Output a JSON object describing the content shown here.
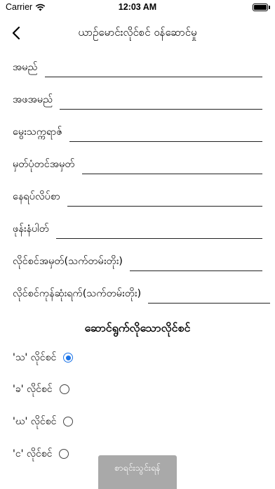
{
  "status_bar": {
    "carrier": "Carrier",
    "time": "12:03 AM"
  },
  "nav": {
    "title": "ယာဉ်မောင်းလိုင်စင် ဝန်ဆောင်မှု"
  },
  "form": {
    "fields": [
      {
        "label": "အမည်",
        "value": "",
        "placeholder": ""
      },
      {
        "label": "အဖအမည်",
        "value": "",
        "placeholder": ""
      },
      {
        "label": "မွေးသက္ကရာဇ်",
        "value": "",
        "placeholder": ""
      },
      {
        "label": "မှတ်ပုံတင်အမှတ်",
        "value": "",
        "placeholder": ""
      },
      {
        "label": "နေရပ်လိပ်စာ",
        "value": "",
        "placeholder": ""
      },
      {
        "label": "ဖုန်းနံပါတ်",
        "value": "",
        "placeholder": ""
      },
      {
        "label": "လိုင်စင်အမှတ်(သက်တမ်းတိုး)",
        "value": "",
        "placeholder": ""
      },
      {
        "label": "လိုင်စင်ကုန်ဆုံးရက်(သက်တမ်းတိုး)",
        "value": "",
        "placeholder": ""
      }
    ]
  },
  "license_section": {
    "title": "ဆောင်ရွက်လိုသောလိုင်စင်",
    "options": [
      {
        "label": "'သ' လိုင်စင်",
        "selected": true
      },
      {
        "label": "'ခ' လိုင်စင်",
        "selected": false
      },
      {
        "label": "'ဃ' လိုင်စင်",
        "selected": false
      },
      {
        "label": "'င' လိုင်စင်",
        "selected": false
      }
    ]
  },
  "submit_button": {
    "label": "စာရင်းသွင်းရန်"
  },
  "colors": {
    "accent": "#1a73e8",
    "button_bg": "#a9a9a9"
  }
}
